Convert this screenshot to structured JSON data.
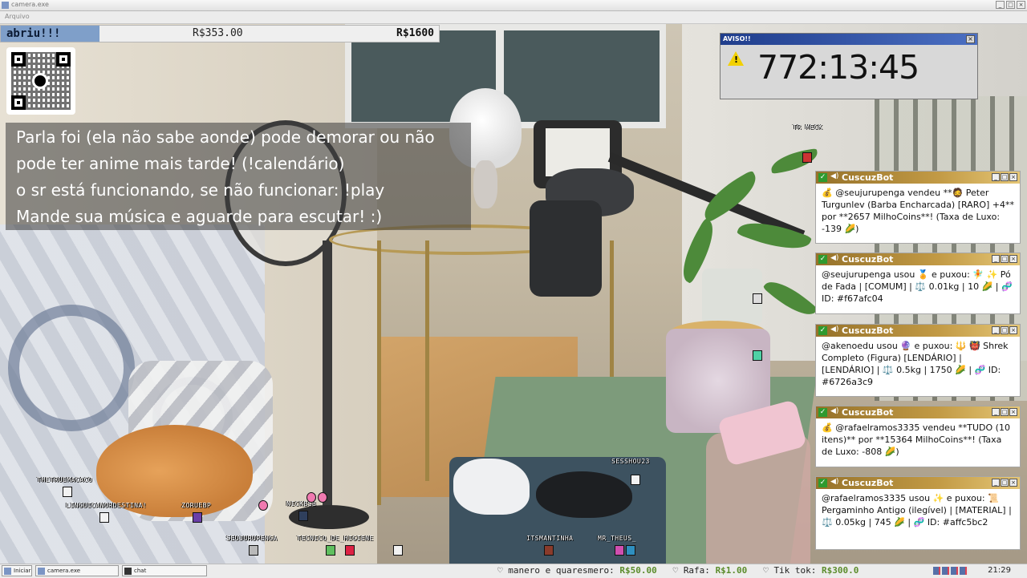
{
  "window": {
    "title": "camera.exe",
    "menu": "Arquivo"
  },
  "status_bar": {
    "label": "abriu!!!",
    "current": "R$353.00",
    "goal": "R$1600"
  },
  "notice_lines": [
    "Parla foi (ela não sabe aonde) pode demorar ou não",
    "pode ter anime mais tarde! (!calendário)",
    "o sr está funcionando, se não funcionar: !play",
    "Mande sua música e aguarde para escutar! :)"
  ],
  "timer": {
    "title": "AVISO!!",
    "close": "×",
    "value": "772:13:45",
    "icon": "warning-icon"
  },
  "bot_cards": [
    {
      "name": "CuscuzBot",
      "message": "💰 @seujurupenga vendeu **🧔 Peter Turgunlev (Barba Encharcada) [RARO] +4** por **2657 MilhoCoins**! (Taxa de Luxo: -139 🌽)"
    },
    {
      "name": "CuscuzBot",
      "message": "@seujurupenga usou 🏅 e puxou: 🧚 ✨ Pó de Fada | [COMUM] | ⚖️ 0.01kg | 10 🌽 | 🧬 ID: #f67afc04"
    },
    {
      "name": "CuscuzBot",
      "message": "@akenoedu usou 🔮 e puxou: 🔱 👹 Shrek Completo (Figura) [LENDÁRIO] | [LENDÁRIO] | ⚖️ 0.5kg | 1750 🌽 | 🧬 ID: #6726a3c9"
    },
    {
      "name": "CuscuzBot",
      "message": "💰 @rafaelramos3335 vendeu **TUDO (10 itens)** por **15364 MilhoCoins**! (Taxa de Luxo: -808 🌽)"
    },
    {
      "name": "CuscuzBot",
      "message": "@rafaelramos3335 usou ✨ e puxou: 📜 Pergaminho Antigo (ilegível) | [MATERIAL] | ⚖️ 0.05kg | 745 🌽 | 🧬 ID: #affc5bc2"
    }
  ],
  "avatars": [
    "TR MECK",
    "THETRUEMACACO",
    "LINGUICANORDESTINA!",
    "ZORUEBP",
    "NICKBSB",
    "SEUJURUPENGA",
    "TECNICO_DE_HIGIENE",
    "SESSHOU23",
    "ITSMANTINHA",
    "MR_THEUS_"
  ],
  "taskbar": {
    "start": "Iniciar",
    "tasks": [
      "camera.exe",
      "chat"
    ],
    "ticker": [
      {
        "name": "manero e quaresmero:",
        "amount": "R$50.00"
      },
      {
        "name": "Rafa:",
        "amount": "R$1.00"
      },
      {
        "name": "Tik tok:",
        "amount": "R$300.0"
      }
    ],
    "clock": "21:29"
  }
}
